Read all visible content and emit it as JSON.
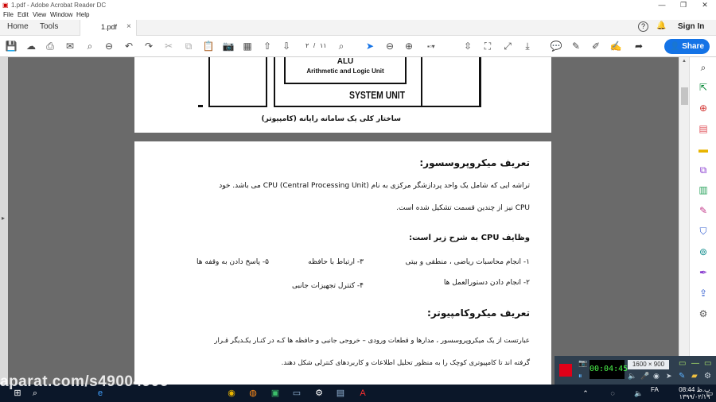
{
  "window": {
    "title": "1.pdf - Adobe Acrobat Reader DC",
    "min": "—",
    "max": "❐",
    "close": "✕"
  },
  "menu": {
    "file": "File",
    "edit": "Edit",
    "view": "View",
    "window": "Window",
    "help": "Help"
  },
  "nav": {
    "home": "Home",
    "tools": "Tools",
    "doc_tab": "1.pdf",
    "close": "×",
    "help": "?",
    "bell": "🔔",
    "signin": "Sign In"
  },
  "toolbar": {
    "page_current": "۲",
    "page_sep": "/",
    "page_total": "۱۱",
    "share": "Share"
  },
  "figure": {
    "alu": "ALU",
    "alu_sub": "Arithmetic and Logic Unit",
    "system_unit": "SYSTEM UNIT",
    "caption": "ساختار کلی یک سامانه رایانه (کامپیوتر)"
  },
  "content": {
    "h1": "تعریف میکروپروسسور:",
    "p1_line1": "تراشه ایی که شامل یک واحد پردازشگر مرکزی به نام  CPU  (Central Processing Unit)  می باشد. خود",
    "p1_line2": "CPU نیز از چندین قسمت تشکیل شده است.",
    "h2": "وظایف CPU به شرح زیر است:",
    "i1": "۱- انجام محاسبات ریاضی ، منطقی و بیتی",
    "i2": "۲- انجام دادن دستورالعمل ها",
    "i3": "۳- ارتباط با حافظه",
    "i4": "۴- کنترل تجهیزات جانبی",
    "i5": "۵- پاسخ دادن به وقفه ها",
    "h3": "تعریف میکروکامپیوتر:",
    "p3_line1": "عبارتست از یک میکروپروسسور ، مدارها و قطعات ورودی – خروجی جانبی و حافظه ها کـه در کنـار یکـدیگر قـرار",
    "p3_line2": "گرفته اند تا کامپیوتری کوچک را به منظور تحلیل اطلاعات و کاربردهای کنترلی شکل دهند."
  },
  "recorder": {
    "time": "00:04:45",
    "resolution": "1600 × 900"
  },
  "taskbar": {
    "watermark": "aparat.com/s49004906",
    "clock_time": "08:44 ب.ظ",
    "clock_date": "۱۳۹۹/۰۲/۱۹",
    "lang": "FA"
  },
  "colors": {
    "accent": "#1473e6",
    "record": "#e00018",
    "taskbar": "#0b1729"
  }
}
